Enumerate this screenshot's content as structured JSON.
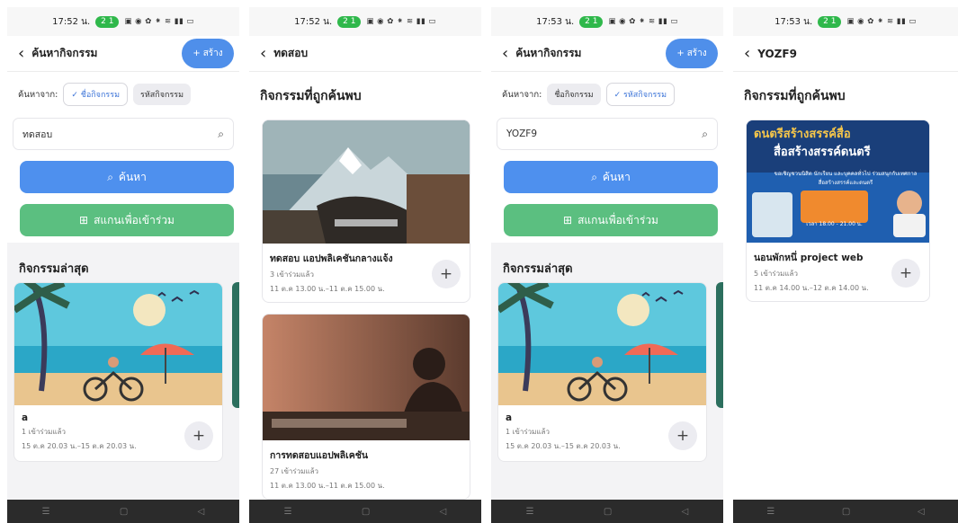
{
  "status": {
    "s1": {
      "time": "17:52 น.",
      "pill": "2 1"
    },
    "s2": {
      "time": "17:52 น.",
      "pill": "2 1"
    },
    "s3": {
      "time": "17:53 น.",
      "pill": "2 1"
    },
    "s4": {
      "time": "17:53 น.",
      "pill": "2 1"
    },
    "icons": "▣ ◉ ✿ ⁕ ≋ ▮▮ ▭"
  },
  "icons": {
    "back": "back-chevron-icon",
    "search": "search-icon",
    "scan": "qr-scan-icon",
    "plus": "plus-icon",
    "check": "check-icon"
  },
  "screen1": {
    "title": "ค้นหากิจกรรม",
    "create_label": "สร้าง",
    "search_from_label": "ค้นหาจาก:",
    "chip_name": "ชื่อกิจกรรม",
    "chip_code": "รหัสกิจกรรม",
    "search_value": "ทดสอบ",
    "search_btn": "ค้นหา",
    "scan_btn": "สแกนเพื่อเข้าร่วม",
    "recent_title": "กิจกรรมล่าสุด",
    "recent_card": {
      "title": "a",
      "joined": "1 เข้าร่วมแล้ว",
      "date": "15 ต.ค 20.03 น.–15 ต.ค 20.03 น."
    }
  },
  "screen2": {
    "title": "ทดสอบ",
    "found_title": "กิจกรรมที่ถูกค้นพบ",
    "results": [
      {
        "title": "ทดสอบ แอปพลิเคชันกลางแจ้ง",
        "joined": "3 เข้าร่วมแล้ว",
        "date": "11 ต.ค 13.00 น.–11 ต.ค 15.00 น."
      },
      {
        "title": "การทดสอบแอปพลิเคชัน",
        "joined": "27 เข้าร่วมแล้ว",
        "date": "11 ต.ค 13.00 น.–11 ต.ค 15.00 น."
      }
    ]
  },
  "screen3": {
    "title": "ค้นหากิจกรรม",
    "create_label": "สร้าง",
    "search_from_label": "ค้นหาจาก:",
    "chip_name": "ชื่อกิจกรรม",
    "chip_code": "รหัสกิจกรรม",
    "search_value": "YOZF9",
    "search_btn": "ค้นหา",
    "scan_btn": "สแกนเพื่อเข้าร่วม",
    "recent_title": "กิจกรรมล่าสุด",
    "recent_card": {
      "title": "a",
      "joined": "1 เข้าร่วมแล้ว",
      "date": "15 ต.ค 20.03 น.–15 ต.ค 20.03 น."
    }
  },
  "screen4": {
    "title": "YOZF9",
    "found_title": "กิจกรรมที่ถูกค้นพบ",
    "poster_headline_1": "ดนตรีสร้างสรรค์สื่อ",
    "poster_headline_2": "สื่อสร้างสรรค์ดนตรี",
    "poster_line": "ขอเชิญชวนนิสิต นักเรียน และบุคคลทั่วไป ร่วมสนุกกับเทศกาลสื่อสร้างสรรค์และดนตรี",
    "poster_time": "เวลา 18.00 - 21.00 น.",
    "results": [
      {
        "title": "นอนพักหนึ่ project web",
        "joined": "5 เข้าร่วมแล้ว",
        "date": "11 ต.ค 14.00 น.–12 ต.ค 14.00 น."
      }
    ]
  },
  "nav": {
    "menu": "☰",
    "home": "▢",
    "back": "◁"
  }
}
